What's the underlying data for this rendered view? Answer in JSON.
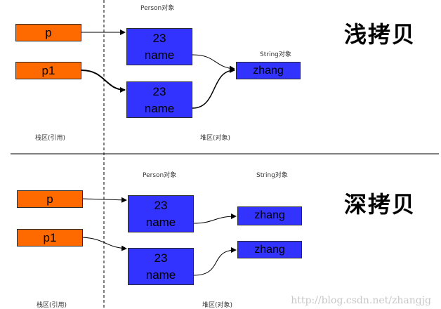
{
  "shallow": {
    "title": "浅拷贝",
    "person_label": "Person对象",
    "string_label": "String对象",
    "stack_label": "栈区(引用)",
    "heap_label": "堆区(对象)",
    "ref1": "p",
    "ref2": "p1",
    "obj1": {
      "value": "23",
      "field": "name"
    },
    "obj2": {
      "value": "23",
      "field": "name"
    },
    "str1": "zhang"
  },
  "deep": {
    "title": "深拷贝",
    "person_label": "Person对象",
    "string_label": "String对象",
    "stack_label": "栈区(引用)",
    "heap_label": "堆区(对象)",
    "ref1": "p",
    "ref2": "p1",
    "obj1": {
      "value": "23",
      "field": "name"
    },
    "obj2": {
      "value": "23",
      "field": "name"
    },
    "str1": "zhang",
    "str2": "zhang"
  },
  "watermark": "http://blog.csdn.net/zhangjg",
  "colors": {
    "reference": "#ff6a00",
    "object": "#3333ff"
  }
}
